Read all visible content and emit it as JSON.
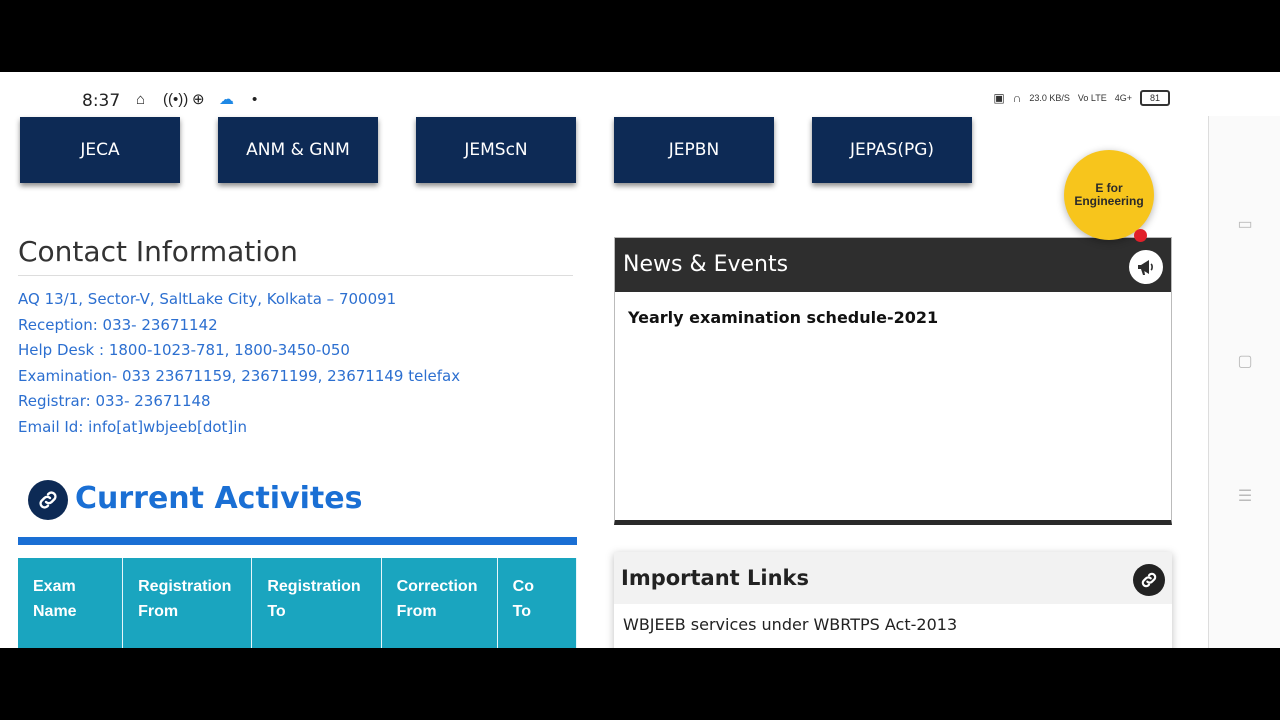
{
  "status_bar": {
    "time": "8:37",
    "right_indicators": [
      "23.0 KB/S",
      "Vo LTE",
      "4G+"
    ],
    "battery": "81"
  },
  "exam_tabs": [
    {
      "label": "JECA"
    },
    {
      "label": "ANM & GNM"
    },
    {
      "label": "JEMScN"
    },
    {
      "label": "JEPBN"
    },
    {
      "label": "JEPAS(PG)"
    }
  ],
  "contact": {
    "title": "Contact Information",
    "lines": [
      "AQ 13/1, Sector-V, SaltLake City, Kolkata – 700091",
      "Reception: 033- 23671142",
      "Help Desk : 1800-1023-781, 1800-3450-050",
      "Examination- 033 23671159, 23671199, 23671149 telefax",
      "Registrar: 033- 23671148",
      "Email Id: info[at]wbjeeb[dot]in"
    ]
  },
  "current_activities": {
    "title": "Current Activites",
    "columns": [
      [
        "Exam Name",
        ""
      ],
      [
        "Registration",
        "From"
      ],
      [
        "Registration",
        "To"
      ],
      [
        "Correction",
        "From"
      ],
      [
        "Co",
        "To"
      ]
    ]
  },
  "news": {
    "title": "News & Events",
    "items": [
      "Yearly examination schedule-2021"
    ]
  },
  "badge": {
    "line1": "E for",
    "line2": "Engineering"
  },
  "important_links": {
    "title": "Important Links",
    "items": [
      "WBJEEB services under WBRTPS Act-2013"
    ]
  }
}
